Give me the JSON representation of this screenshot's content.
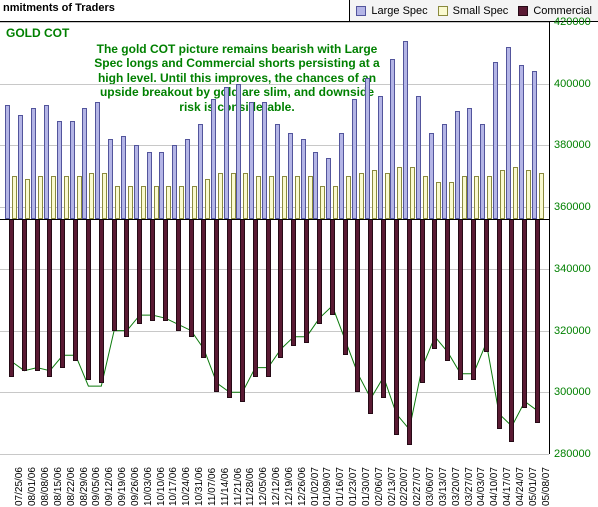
{
  "header": {
    "title": "nmitments of Traders"
  },
  "legend": {
    "large": "Large Spec",
    "small": "Small Spec",
    "commercial": "Commercial"
  },
  "subtitle": "GOLD COT",
  "annotation": "The gold COT picture remains bearish with Large Spec longs and Commercial shorts persisting at a high level. Until this improves, the chances of an upside breakout by gold are slim, and downside risk is considerable.",
  "chart_data": {
    "type": "bar",
    "title": "GOLD COT",
    "ylabel": "",
    "xlabel": "",
    "ylim": [
      280000,
      420000
    ],
    "yticks": [
      280000,
      300000,
      320000,
      340000,
      360000,
      380000,
      400000,
      420000
    ],
    "baseline": 356000,
    "categories": [
      "07/25/06",
      "08/01/06",
      "08/08/06",
      "08/15/06",
      "08/22/06",
      "08/29/06",
      "09/05/06",
      "09/12/06",
      "09/19/06",
      "09/26/06",
      "10/03/06",
      "10/10/06",
      "10/17/06",
      "10/24/06",
      "10/31/06",
      "11/07/06",
      "11/14/06",
      "11/21/06",
      "11/28/06",
      "12/05/06",
      "12/12/06",
      "12/19/06",
      "12/26/06",
      "01/02/07",
      "01/09/07",
      "01/16/07",
      "01/23/07",
      "01/30/07",
      "02/06/07",
      "02/13/07",
      "02/20/07",
      "02/27/07",
      "03/06/07",
      "03/13/07",
      "03/20/07",
      "03/27/07",
      "04/03/07",
      "04/10/07",
      "04/17/07",
      "04/24/07",
      "05/01/07",
      "05/08/07"
    ],
    "series": [
      {
        "name": "Large Spec",
        "values": [
          393000,
          390000,
          392000,
          393000,
          388000,
          388000,
          392000,
          394000,
          382000,
          383000,
          380000,
          378000,
          378000,
          380000,
          382000,
          387000,
          395000,
          399000,
          400000,
          394000,
          394000,
          387000,
          384000,
          382000,
          378000,
          376000,
          384000,
          395000,
          402000,
          396000,
          408000,
          414000,
          396000,
          384000,
          387000,
          391000,
          392000,
          387000,
          407000,
          412000,
          406000,
          404000
        ]
      },
      {
        "name": "Small Spec",
        "values": [
          370000,
          369000,
          370000,
          370000,
          370000,
          370000,
          371000,
          371000,
          367000,
          367000,
          367000,
          367000,
          367000,
          367000,
          367000,
          369000,
          371000,
          371000,
          371000,
          370000,
          370000,
          370000,
          370000,
          370000,
          367000,
          367000,
          370000,
          371000,
          372000,
          371000,
          373000,
          373000,
          370000,
          368000,
          368000,
          370000,
          370000,
          370000,
          372000,
          373000,
          372000,
          371000
        ]
      },
      {
        "name": "Commercial",
        "values": [
          305000,
          307000,
          307000,
          305000,
          308000,
          310000,
          304000,
          303000,
          320000,
          318000,
          322000,
          323000,
          323000,
          320000,
          318000,
          311000,
          300000,
          298000,
          297000,
          305000,
          305000,
          311000,
          315000,
          316000,
          322000,
          325000,
          312000,
          300000,
          293000,
          298000,
          286000,
          283000,
          303000,
          314000,
          310000,
          304000,
          304000,
          313000,
          288000,
          284000,
          295000,
          290000
        ]
      }
    ],
    "open_interest_line": [
      310000,
      307000,
      308000,
      307000,
      312000,
      312000,
      302000,
      302000,
      320000,
      320000,
      325000,
      325000,
      324000,
      322000,
      320000,
      314000,
      303000,
      300000,
      300000,
      308000,
      308000,
      314000,
      318000,
      318000,
      324000,
      328000,
      317000,
      306000,
      298000,
      305000,
      293000,
      288000,
      308000,
      318000,
      313000,
      306000,
      306000,
      316000,
      293000,
      289000,
      297000,
      294000
    ]
  }
}
